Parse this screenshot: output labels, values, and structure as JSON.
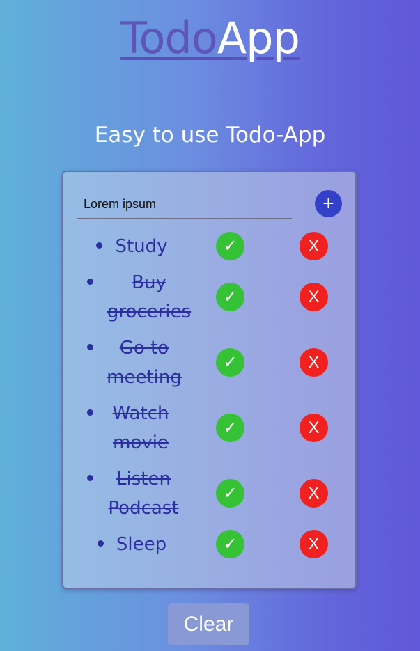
{
  "header": {
    "logo_part1": "Todo",
    "logo_part2": "App",
    "subtitle": "Easy to use Todo-App"
  },
  "form": {
    "input_value": "Lorem ipsum",
    "add_label": "+"
  },
  "tasks": [
    {
      "text": "Study",
      "completed": false
    },
    {
      "text": "Buy groceries",
      "completed": true
    },
    {
      "text": "Go to meeting",
      "completed": true
    },
    {
      "text": "Watch movie",
      "completed": true
    },
    {
      "text": "Listen Podcast",
      "completed": true
    },
    {
      "text": "Sleep",
      "completed": false
    }
  ],
  "actions": {
    "complete_label": "✓",
    "delete_label": "X",
    "clear_label": "Clear"
  },
  "colors": {
    "accent": "#3340c8",
    "complete": "#35c235",
    "delete": "#f0211f",
    "task_text": "#2c2fa0"
  }
}
